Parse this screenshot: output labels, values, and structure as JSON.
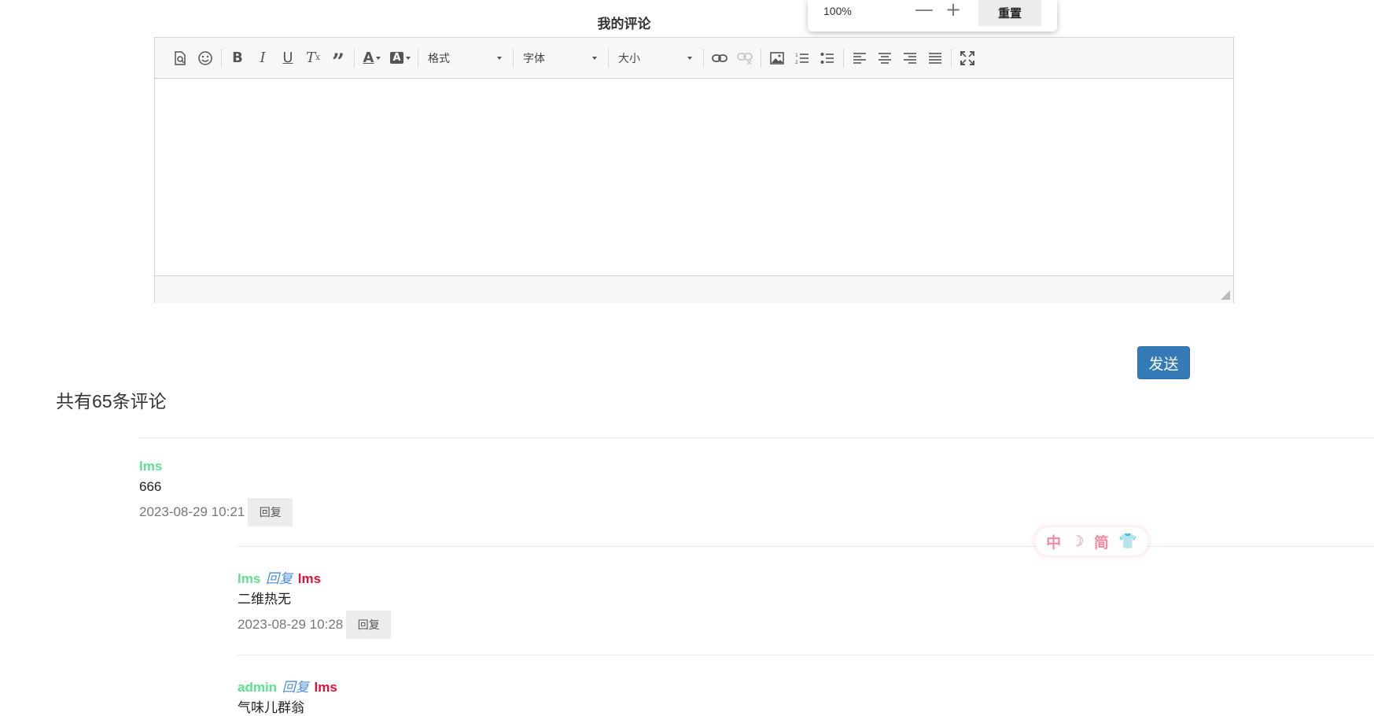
{
  "page_title": "我的评论",
  "zoom": {
    "level": "100%",
    "minus": "—",
    "plus": "+",
    "reset_label": "重置"
  },
  "toolbar": {
    "format_label": "格式",
    "font_label": "字体",
    "size_label": "大小"
  },
  "send_label": "发送",
  "comment_count_text": "共有65条评论",
  "comments": [
    {
      "user": "lms",
      "body": "666",
      "time": "2023-08-29 10:21",
      "reply_label": "回复"
    },
    {
      "user": "lms",
      "reply_word": "回复",
      "target": "lms",
      "body": "二维热无",
      "time": "2023-08-29 10:28",
      "reply_label": "回复"
    },
    {
      "user": "admin",
      "reply_word": "回复",
      "target": "lms",
      "body": "气味儿群翁"
    }
  ],
  "widget": {
    "chinese": "中",
    "moon": "☽",
    "simplified": "简",
    "shirt": "👕"
  },
  "colors": {
    "accent_send": "#337ab7",
    "username": "#5ee08f",
    "reply_target": "#e0113c",
    "reply_word": "#4a8bd6",
    "widget_pink": "#f48aa0"
  }
}
